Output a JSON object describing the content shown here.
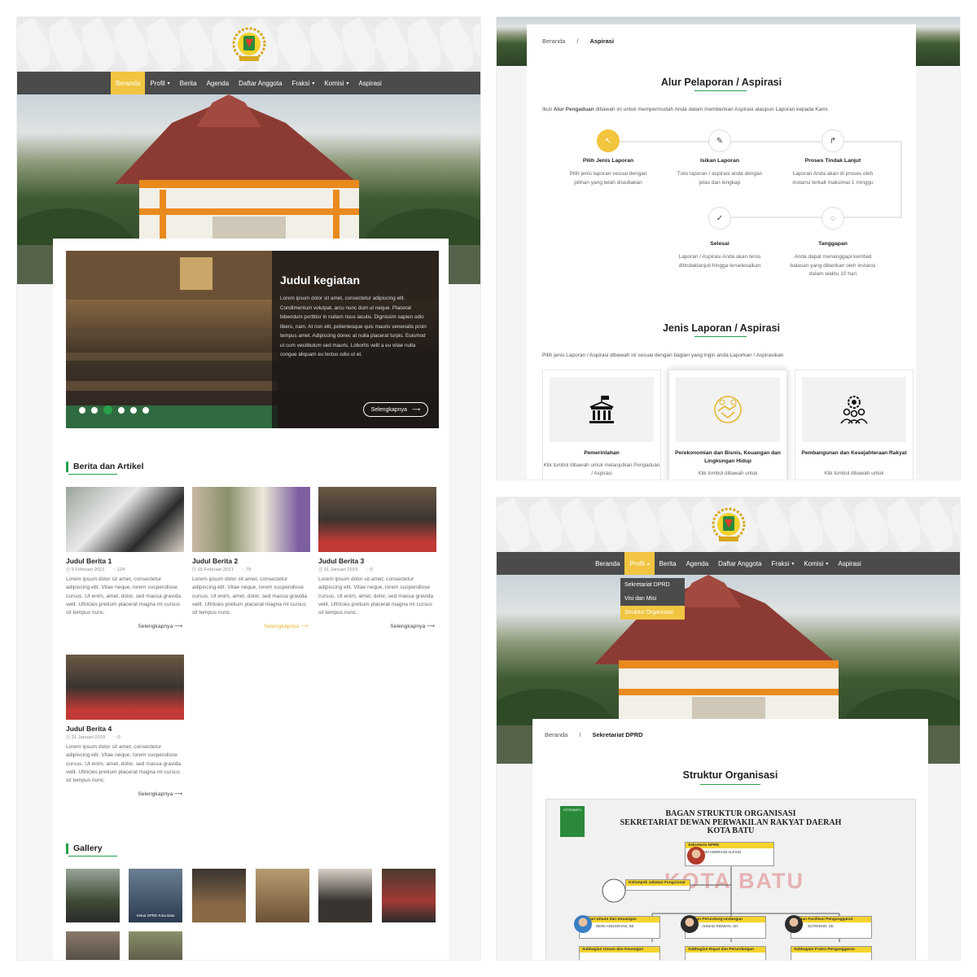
{
  "nav": {
    "items": [
      {
        "label": "Beranda",
        "dropdown": false
      },
      {
        "label": "Profil",
        "dropdown": true
      },
      {
        "label": "Berita",
        "dropdown": false
      },
      {
        "label": "Agenda",
        "dropdown": false
      },
      {
        "label": "Daftar Anggota",
        "dropdown": false
      },
      {
        "label": "Fraksi",
        "dropdown": true
      },
      {
        "label": "Komisi",
        "dropdown": true
      },
      {
        "label": "Aspirasi",
        "dropdown": false
      }
    ],
    "chevron": "⌄"
  },
  "home": {
    "slide": {
      "title": "Judul kegiatan",
      "text": "Lorem ipsum dolor sit amet, consectetur adipiscing elit. Condimentum volutpat, arcu nunc dum ut neque. Placerat bibendum porttitor in nullam risus iaculis. Dignissim sapien odio libero, nam. At non elit, pellentesque quis mauris venenatis proin tempus amet. Adipiscing donec at nulla placerat turpis. Euismod ut cum vestibulum sed mauris. Lobortis velit a eu vitae nulla congue aliquam eu lectus odio ut et.",
      "button": "Selengkapnya",
      "dots": 6,
      "active_dot": 2
    },
    "news_heading": "Berita dan Artikel",
    "news": [
      {
        "title": "Judul Berita 1",
        "date": "9 Februari 2021",
        "comments": "124",
        "excerpt": "Lorem ipsum dolor sit amet, consectetur adipiscing elit. Vitae neque, lorem suspendisse cursus. Ut enim, amet, dolor, sed massa gravida velit. Ultricies pretium placerat magna mi cursus sit tempus nunc.",
        "more": "Selengkapnya"
      },
      {
        "title": "Judul Berita 2",
        "date": "15 Februari 2021",
        "comments": "79",
        "excerpt": "Lorem ipsum dolor sit amet, consectetur adipiscing elit. Vitae neque, lorem suspendisse cursus. Ut enim, amet, dolor, sed massa gravida velit. Ultricies pretium placerat magna mi cursus sit tempus nunc.",
        "more": "Selengkapnya"
      },
      {
        "title": "Judul Berita 3",
        "date": "31 Januari 2019",
        "comments": "0",
        "excerpt": "Lorem ipsum dolor sit amet, consectetur adipiscing elit. Vitae neque, lorem suspendisse cursus. Ut enim, amet, dolor, sed massa gravida velit. Ultricies pretium placerat magna mi cursus sit tempus nunc.",
        "more": "Selengkapnya"
      },
      {
        "title": "Judul Berita 4",
        "date": "31 Januari 2019",
        "comments": "0",
        "excerpt": "Lorem ipsum dolor sit amet, consectetur adipiscing elit. Vitae neque, lorem suspendisse cursus. Ut enim, amet, dolor, sed massa gravida velit. Ultricies pretium placerat magna mi cursus sit tempus nunc.",
        "more": "Selengkapnya"
      }
    ],
    "gallery_heading": "Gallery",
    "gallery_caption": "Ketua DPRD Kota Batu"
  },
  "aspirasi": {
    "breadcrumb": [
      "Beranda",
      "/",
      "Aspirasi"
    ],
    "alur_title": "Alur Pelaporan / Aspirasi",
    "alur_intro_pre": "Ikuti ",
    "alur_intro_bold": "Alur Pengaduan",
    "alur_intro_post": " dibawah ini untuk mempermudah Anda dalam memberikan Aspirasi ataupun Laporan kepada Kami.",
    "steps": [
      {
        "icon": "↖",
        "title": "Pilih Jenis Laporan",
        "desc": "Pilih jenis laporan sesuai dengan pilihan yang telah disediakan"
      },
      {
        "icon": "✎",
        "title": "Isikan Laporan",
        "desc": "Tulis laporan / aspirasi anda dengan jelas dan lengkap"
      },
      {
        "icon": "↱",
        "title": "Proses Tindak Lanjut",
        "desc": "Laporan Anda akan di proses oleh instansi terkait maksimal 1 minggu"
      },
      {
        "icon": "✓",
        "title": "Selesai",
        "desc": "Laporan / Aspirasi Anda akan terus ditindaklanjuti hingga terselesaikan"
      },
      {
        "icon": "◌",
        "title": "Tanggapan",
        "desc": "Anda dapat menanggapi kembali balasan yang diberikan oleh instansi dalam waktu 10 hari"
      }
    ],
    "jenis_title": "Jenis Laporan / Aspirasi",
    "jenis_intro": "Pilih jenis Laporan / Aspirasi dibawah ini sesuai dengan bagian yang ingin anda Laporkan / Aspirasikan",
    "jenis": [
      {
        "title": "Pemerintahan",
        "desc": "Klik tombol dibawah untuk melanjutkan Pengaduan / Aspirasi"
      },
      {
        "title": "Perekonomian dan Bisnis, Keuangan dan Lingkungan Hidup",
        "desc": "Klik tombol dibawah untuk"
      },
      {
        "title": "Pembangunan dan Kesejahteraan Rakyat",
        "desc": "Klik tombol dibawah untuk"
      }
    ]
  },
  "profil": {
    "dropdown": [
      "Sekretariat DPRD",
      "Visi dan Misi",
      "Struktur Organisasi"
    ],
    "breadcrumb": [
      "Beranda",
      "/",
      "Sekretariat DPRD"
    ],
    "title": "Struktur Organisasi",
    "org_title": [
      "BAGAN STRUKTUR ORGANISASI",
      "SEKRETARIAT DEWAN PERWAKILAN RAKYAT DAERAH",
      "KOTA BATU"
    ],
    "kota": "KOTA BATU",
    "watermark": "KOTA BATU",
    "boxes": [
      {
        "head": "Sekretaris DPRD",
        "body": "DWI ANDRIANI ALFIAN"
      },
      {
        "head": "Kelompok Jabatan Fungsional",
        "body": ""
      },
      {
        "head": "Bagian Umum dan Keuangan",
        "body": "DEWI ANGGRAINI, SE"
      },
      {
        "head": "Bagian Perundang-undangan",
        "body": "AHMAD RIDWAN, SH"
      },
      {
        "head": "Bagian Fasilitasi Penganggaran",
        "body": "SUTRISNO, SE"
      },
      {
        "head": "Subbagian Umum dan Keuangan",
        "body": ""
      },
      {
        "head": "Subbagian Rapat dan Perundangan",
        "body": ""
      },
      {
        "head": "Subbagian Fraksi Penganggaran",
        "body": ""
      }
    ]
  },
  "colors": {
    "accent": "#f1c541",
    "green": "#22a04b",
    "nav": "#4b4b4b"
  }
}
